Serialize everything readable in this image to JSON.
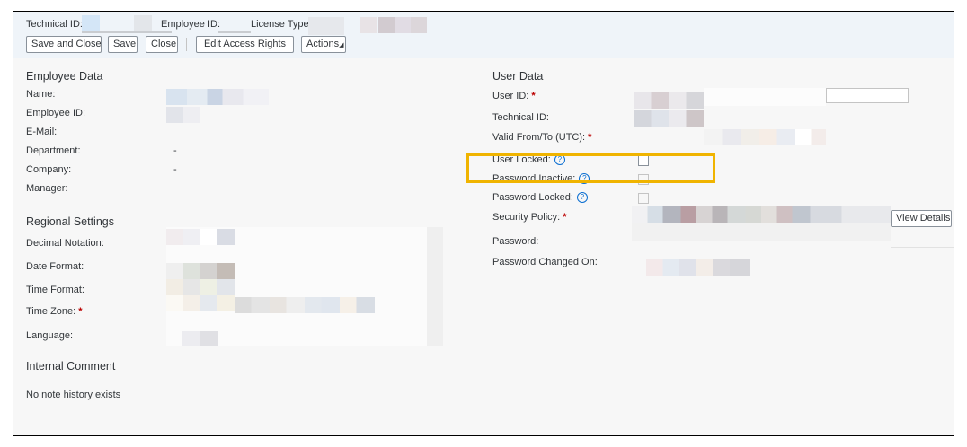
{
  "header": {
    "technical_id_label": "Technical ID:",
    "employee_id_label": "Employee ID:",
    "license_type_label": "License Type:"
  },
  "toolbar": {
    "save_close_label": "Save and Close",
    "save_label": "Save",
    "close_label": "Close",
    "edit_access_label": "Edit Access Rights",
    "actions_label": "Actions"
  },
  "employee_data": {
    "title": "Employee Data",
    "name_label": "Name:",
    "employee_id_label": "Employee ID:",
    "email_label": "E-Mail:",
    "department_label": "Department:",
    "department_value": "-",
    "company_label": "Company:",
    "company_value": "-",
    "manager_label": "Manager:"
  },
  "regional_settings": {
    "title": "Regional Settings",
    "decimal_label": "Decimal Notation:",
    "date_label": "Date Format:",
    "time_format_label": "Time Format:",
    "time_zone_label": "Time Zone:",
    "language_label": "Language:"
  },
  "internal_comment": {
    "title": "Internal Comment",
    "text": "No note history exists"
  },
  "user_data": {
    "title": "User Data",
    "user_id_label": "User ID:",
    "technical_id_label": "Technical ID:",
    "valid_label": "Valid From/To (UTC):",
    "user_locked_label": "User Locked:",
    "password_inactive_label": "Password Inactive:",
    "password_locked_label": "Password Locked:",
    "security_policy_label": "Security Policy:",
    "view_details_label": "View Details",
    "password_label": "Password:",
    "password_changed_label": "Password Changed On:",
    "required_mark": "*",
    "help_mark": "?"
  },
  "colors": {
    "highlight": "#f0b400",
    "required": "#bb0000",
    "help": "#0a6ed1"
  }
}
